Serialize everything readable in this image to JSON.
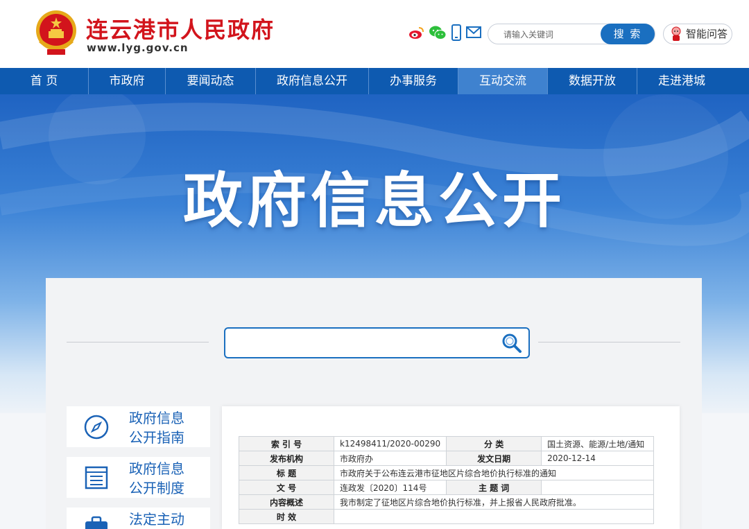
{
  "header": {
    "site_name": "连云港市人民政府",
    "site_url": "www.lyg.gov.cn",
    "search_placeholder": "请输入关键词",
    "search_button": "搜 索",
    "qa_label": "智能问答",
    "social_icons": [
      "weibo-icon",
      "wechat-icon",
      "mobile-icon",
      "mail-icon"
    ],
    "brand_red": "#d2141c",
    "brand_blue": "#1a6fc0"
  },
  "nav": {
    "items": [
      {
        "label": "首 页"
      },
      {
        "label": "市政府"
      },
      {
        "label": "要闻动态"
      },
      {
        "label": "政府信息公开"
      },
      {
        "label": "办事服务"
      },
      {
        "label": "互动交流"
      },
      {
        "label": "数据开放"
      },
      {
        "label": "走进港城"
      }
    ],
    "active_index": 5
  },
  "banner": {
    "title": "政府信息公开"
  },
  "main_search": {
    "placeholder": ""
  },
  "sidebar": {
    "items": [
      {
        "line1": "政府信息",
        "line2": "公开指南",
        "icon": "compass-icon"
      },
      {
        "line1": "政府信息",
        "line2": "公开制度",
        "icon": "document-list-icon"
      },
      {
        "line1": "法定主动",
        "line2": "",
        "icon": "briefcase-icon"
      }
    ]
  },
  "meta_table": {
    "index_label": "索 引 号",
    "index_value": "k12498411/2020-00290",
    "category_label": "分 类",
    "category_value": "国土资源、能源/土地/通知",
    "publisher_label": "发布机构",
    "publisher_value": "市政府办",
    "date_label": "发文日期",
    "date_value": "2020-12-14",
    "title_label": "标 题",
    "title_value": "市政府关于公布连云港市征地区片综合地价执行标准的通知",
    "doc_no_label": "文 号",
    "doc_no_value": "连政发〔2020〕114号",
    "subject_label": "主 题 词",
    "subject_value": "",
    "summary_label": "内容概述",
    "summary_value": "我市制定了征地区片综合地价执行标准，并上报省人民政府批准。",
    "validity_label": "时 效",
    "validity_value": ""
  }
}
